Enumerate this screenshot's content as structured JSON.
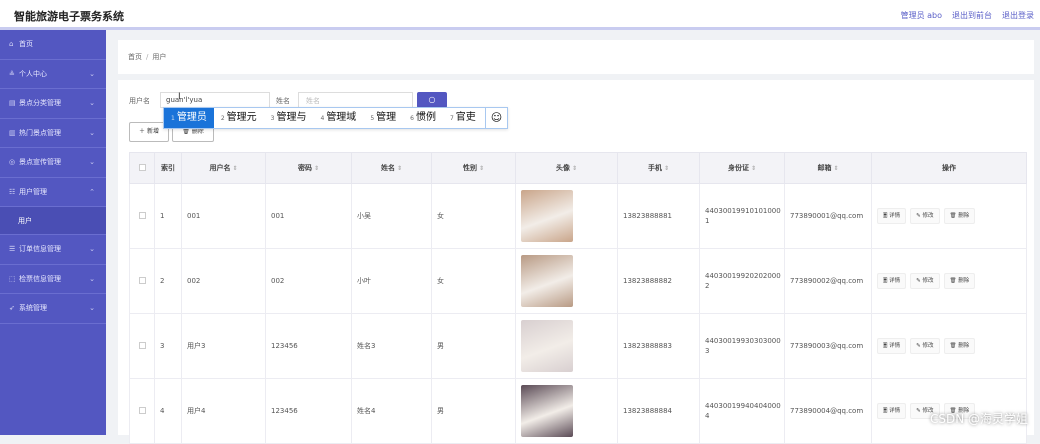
{
  "app": {
    "title": "智能旅游电子票务系统"
  },
  "top_links": {
    "user": "管理员 abo",
    "front": "退出到前台",
    "logout": "退出登录"
  },
  "sidebar": {
    "items": [
      {
        "label": "首页",
        "icon": "home-icon",
        "glyph": "⌂",
        "chev": ""
      },
      {
        "label": "个人中心",
        "icon": "user-icon",
        "glyph": "≗",
        "chev": "⌄"
      },
      {
        "label": "景点分类管理",
        "icon": "grid-icon",
        "glyph": "▤",
        "chev": "⌄"
      },
      {
        "label": "热门景点管理",
        "icon": "chart-icon",
        "glyph": "▥",
        "chev": "⌄"
      },
      {
        "label": "景点宣传管理",
        "icon": "globe-icon",
        "glyph": "◎",
        "chev": "⌄"
      },
      {
        "label": "用户管理",
        "icon": "menu-icon",
        "glyph": "☷",
        "chev": "⌃"
      },
      {
        "label": "订单信息管理",
        "icon": "list-icon",
        "glyph": "☰",
        "chev": "⌄"
      },
      {
        "label": "检票信息管理",
        "icon": "ticket-icon",
        "glyph": "⬚",
        "chev": "⌄"
      },
      {
        "label": "系统管理",
        "icon": "send-icon",
        "glyph": "➶",
        "chev": "⌄"
      }
    ],
    "sub_item": "用户"
  },
  "breadcrumb": {
    "home": "首页",
    "sep": "/",
    "current": "用户"
  },
  "search": {
    "user_label": "用户名",
    "user_value": "guan'l'yua",
    "name_label": "姓名",
    "name_placeholder": "姓名",
    "search_icon": "search-icon",
    "search_glyph": "○"
  },
  "actions": {
    "add": "＋ 新增",
    "delete": "🗑 删除"
  },
  "ime": {
    "candidates": [
      {
        "num": "1",
        "text": "管理员"
      },
      {
        "num": "2",
        "text": "管理元"
      },
      {
        "num": "3",
        "text": "管理与"
      },
      {
        "num": "4",
        "text": "管理域"
      },
      {
        "num": "5",
        "text": "管理"
      },
      {
        "num": "6",
        "text": "惯例"
      },
      {
        "num": "7",
        "text": "官吏"
      }
    ],
    "emoji": "☺"
  },
  "table": {
    "headers": [
      "索引",
      "用户名",
      "密码",
      "姓名",
      "性别",
      "头像",
      "手机",
      "身份证",
      "邮箱",
      "操作"
    ],
    "sort_glyph": "⇕",
    "ops": {
      "detail": "🗏 详情",
      "edit": "✎ 修改",
      "delete": "🗑 删除"
    },
    "rows": [
      {
        "index": "1",
        "username": "001",
        "password": "001",
        "name": "小吴",
        "gender": "女",
        "phone": "13823888881",
        "id_card": "440300199101010001",
        "email": "773890001@qq.com",
        "avatar_color": "#c9a58a"
      },
      {
        "index": "2",
        "username": "002",
        "password": "002",
        "name": "小叶",
        "gender": "女",
        "phone": "13823888882",
        "id_card": "440300199202020002",
        "email": "773890002@qq.com",
        "avatar_color": "#b89a84"
      },
      {
        "index": "3",
        "username": "用户3",
        "password": "123456",
        "name": "姓名3",
        "gender": "男",
        "phone": "13823888883",
        "id_card": "440300199303030003",
        "email": "773890003@qq.com",
        "avatar_color": "#d8cfd0"
      },
      {
        "index": "4",
        "username": "用户4",
        "password": "123456",
        "name": "姓名4",
        "gender": "男",
        "phone": "13823888884",
        "id_card": "440300199404040004",
        "email": "773890004@qq.com",
        "avatar_color": "#5a4a55"
      }
    ]
  },
  "watermark": "CSDN @海灵学姐",
  "colors": {
    "accent": "#5357c1",
    "ime_selected": "#1a73d9"
  }
}
